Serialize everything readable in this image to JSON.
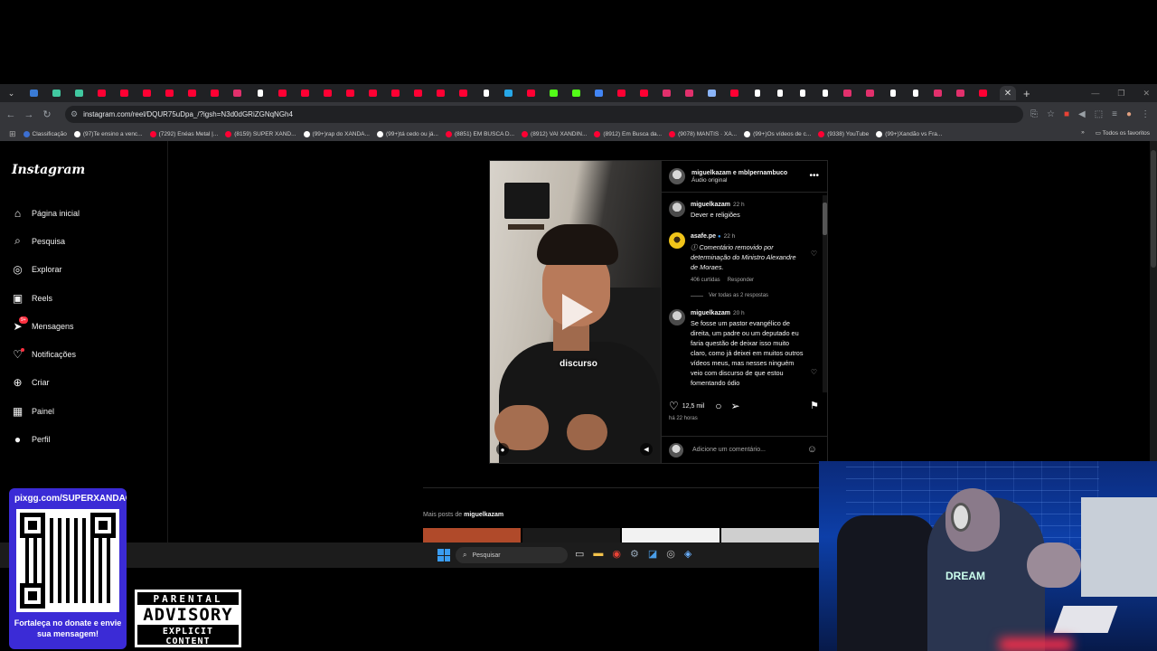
{
  "browser": {
    "url": "instagram.com/reel/DQUR75uDpa_/?igsh=N3d0dGRiZGNqNGh4",
    "tabs": [
      {
        "kind": "edge"
      },
      {
        "kind": "dev"
      },
      {
        "kind": "dev"
      },
      {
        "kind": "youtube"
      },
      {
        "kind": "youtube"
      },
      {
        "kind": "youtube"
      },
      {
        "kind": "youtube"
      },
      {
        "kind": "youtube"
      },
      {
        "kind": "youtube"
      },
      {
        "kind": "instagram"
      },
      {
        "kind": "tiktok"
      },
      {
        "kind": "youtube"
      },
      {
        "kind": "youtube"
      },
      {
        "kind": "youtube"
      },
      {
        "kind": "youtube"
      },
      {
        "kind": "youtube"
      },
      {
        "kind": "youtube"
      },
      {
        "kind": "youtube"
      },
      {
        "kind": "youtube"
      },
      {
        "kind": "youtube"
      },
      {
        "kind": "tiktok"
      },
      {
        "kind": "telegram"
      },
      {
        "kind": "youtube"
      },
      {
        "kind": "kick"
      },
      {
        "kind": "kick"
      },
      {
        "kind": "google"
      },
      {
        "kind": "youtube"
      },
      {
        "kind": "youtube"
      },
      {
        "kind": "instagram"
      },
      {
        "kind": "instagram"
      },
      {
        "kind": "screen"
      },
      {
        "kind": "youtube"
      },
      {
        "kind": "tiktok"
      },
      {
        "kind": "tiktok"
      },
      {
        "kind": "tiktok"
      },
      {
        "kind": "tiktok"
      },
      {
        "kind": "instagram"
      },
      {
        "kind": "instagram"
      },
      {
        "kind": "tiktok"
      },
      {
        "kind": "tiktok"
      },
      {
        "kind": "instagram"
      },
      {
        "kind": "instagram"
      },
      {
        "kind": "youtube"
      }
    ],
    "tab_colors": {
      "youtube": "#ff0033",
      "instagram": "#e1306c",
      "tiktok": "#ffffff",
      "kick": "#53fc18",
      "google": "#4285f4",
      "telegram": "#27a7e7",
      "edge": "#3a7bd5",
      "dev": "#41c8a0",
      "screen": "#8ab4f8"
    },
    "bookmarks": [
      {
        "label": "Classificação",
        "color": "#3c6fd1"
      },
      {
        "label": "(97)Te ensino a venc...",
        "color": "#ffffff"
      },
      {
        "label": "(7292) Enéas Metal |...",
        "color": "#ff0033"
      },
      {
        "label": "(8159) SUPER XAND...",
        "color": "#ff0033"
      },
      {
        "label": "(99+)rap do XANDÃ...",
        "color": "#ffffff"
      },
      {
        "label": "(99+)tá cedo ou já...",
        "color": "#ffffff"
      },
      {
        "label": "(8851) EM BUSCA D...",
        "color": "#ff0033"
      },
      {
        "label": "(8912) VAI XANDIN...",
        "color": "#ff0033"
      },
      {
        "label": "(8912) Em Busca da...",
        "color": "#ff0033"
      },
      {
        "label": "(9078) MANTIS · XA...",
        "color": "#ff0033"
      },
      {
        "label": "(99+)Os vídeos de c...",
        "color": "#ffffff"
      },
      {
        "label": "(9338) YouTube",
        "color": "#ff0033"
      },
      {
        "label": "(99+)Xandão vs Fra...",
        "color": "#ffffff"
      }
    ],
    "bookmarks_more": "»",
    "all_favorites": "Todos os favoritos"
  },
  "instagram": {
    "logo": "Instagram",
    "nav": [
      {
        "label": "Página inicial",
        "icon": "home-icon"
      },
      {
        "label": "Pesquisa",
        "icon": "search-icon"
      },
      {
        "label": "Explorar",
        "icon": "compass-icon"
      },
      {
        "label": "Reels",
        "icon": "reels-icon"
      },
      {
        "label": "Mensagens",
        "icon": "messenger-icon",
        "badge": "9+"
      },
      {
        "label": "Notificações",
        "icon": "heart-icon"
      },
      {
        "label": "Criar",
        "icon": "plus-icon"
      },
      {
        "label": "Painel",
        "icon": "chart-icon"
      },
      {
        "label": "Perfil",
        "icon": "profile-icon"
      }
    ],
    "post": {
      "header_names": "miguelkazam e mblpernambuco",
      "audio": "Áudio original",
      "video_caption": "discurso",
      "comments": [
        {
          "user": "miguelkazam",
          "time": "22 h",
          "text": "Dever e religiões"
        },
        {
          "user": "asafe.pe",
          "time": "22 h",
          "text": "ⓘ Comentário removido por determinação do Ministro Alexandre de Moraes.",
          "likes": "406 curtidas",
          "reply": "Responder",
          "view_replies": "Ver todas as 2 respostas"
        },
        {
          "user": "miguelkazam",
          "time": "20 h",
          "text": "Se fosse um pastor evangélico de direita, um padre ou um deputado eu faria questão de deixar isso muito claro, como já deixei em muitos outros vídeos meus, mas nesses ninguém veio com discurso de que estou fomentando ódio"
        }
      ],
      "likes": "12,5 mil",
      "time_ago": "há 22 horas",
      "add_comment_placeholder": "Adicione um comentário..."
    },
    "more_posts_prefix": "Mais posts de",
    "more_posts_user": "miguelkazam"
  },
  "taskbar": {
    "search_placeholder": "Pesquisar"
  },
  "overlays": {
    "donate_url": "pixgg.com/SUPERXANDAO",
    "donate_message": "Fortaleça no donate e envie sua mensagem!",
    "advisory_line1": "PARENTAL",
    "advisory_line2": "ADVISORY",
    "advisory_line3": "EXPLICIT CONTENT",
    "webcam_shirt": "DREAM"
  }
}
